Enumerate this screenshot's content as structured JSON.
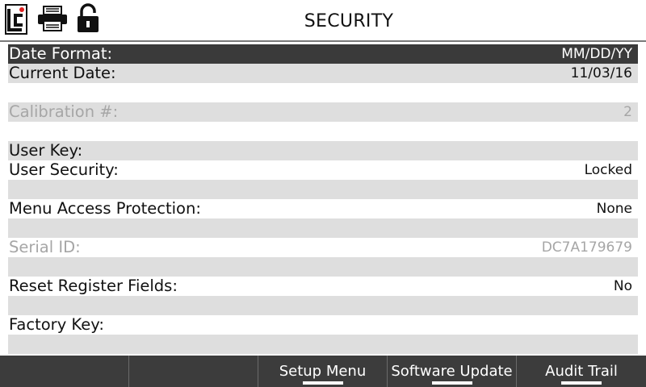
{
  "header": {
    "title": "SECURITY",
    "icons": [
      "logo-icon",
      "printer-icon",
      "unlock-icon"
    ],
    "logo_text": "LC",
    "logo_dot_color": "#e02020"
  },
  "rows": [
    {
      "label": "Date Format:",
      "value": "MM/DD/YY",
      "state": "selected"
    },
    {
      "label": "Current Date:",
      "value": "11/03/16",
      "state": "normal"
    },
    {
      "label": "Calibration #:",
      "value": "2",
      "state": "disabled"
    },
    {
      "label": "User Key:",
      "value": "",
      "state": "normal"
    },
    {
      "label": "User Security:",
      "value": "Locked",
      "state": "normal"
    },
    {
      "label": "Menu Access Protection:",
      "value": "None",
      "state": "normal"
    },
    {
      "label": "Serial ID:",
      "value": "DC7A179679",
      "state": "disabled"
    },
    {
      "label": "Reset Register Fields:",
      "value": "No",
      "state": "normal"
    },
    {
      "label": "Factory Key:",
      "value": "",
      "state": "normal"
    }
  ],
  "softkeys": [
    {
      "label": ""
    },
    {
      "label": ""
    },
    {
      "label": "Setup Menu"
    },
    {
      "label": "Software Update"
    },
    {
      "label": "Audit Trail"
    }
  ],
  "colors": {
    "selected_row": "#3a3a3a",
    "shaded_row": "#dedede",
    "disabled_text": "#a6a6a6",
    "footer": "#3c3c3c"
  }
}
